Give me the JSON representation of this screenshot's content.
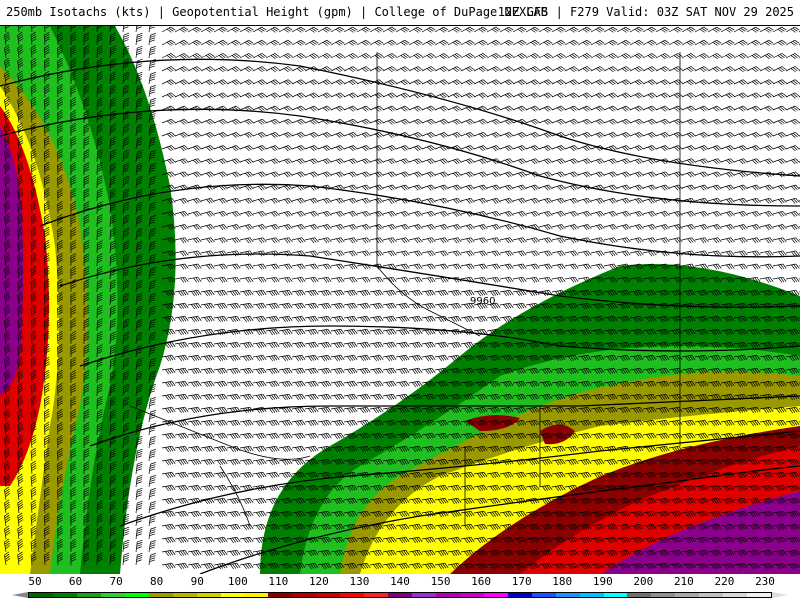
{
  "header": {
    "title_left": "250mb Isotachs (kts) | Geopotential Height (gpm) | College of DuPage NEXLAB",
    "title_right": "12Z GFS | F279 Valid: 03Z SAT NOV 29 2025"
  },
  "map": {
    "contour_label": "9960"
  },
  "colorbar": {
    "labels": [
      "50",
      "60",
      "70",
      "80",
      "90",
      "100",
      "110",
      "120",
      "130",
      "140",
      "150",
      "160",
      "170",
      "180",
      "190",
      "200",
      "210",
      "220",
      "230"
    ],
    "colors": [
      "#006400",
      "#008000",
      "#1f9d1f",
      "#33cc33",
      "#00ff00",
      "#9a9a00",
      "#b3b300",
      "#d0d000",
      "#ffff00",
      "#fff200",
      "#8b0000",
      "#b00000",
      "#d00000",
      "#ff0000",
      "#ff2020",
      "#800080",
      "#9932cc",
      "#b000b0",
      "#cc00cc",
      "#ff00ff",
      "#0000cd",
      "#1e50ff",
      "#1e90ff",
      "#00bfff",
      "#00ffff",
      "#707070",
      "#909090",
      "#a8a8a8",
      "#c0c0c0",
      "#d8d8d8",
      "#f0f0f0"
    ]
  }
}
